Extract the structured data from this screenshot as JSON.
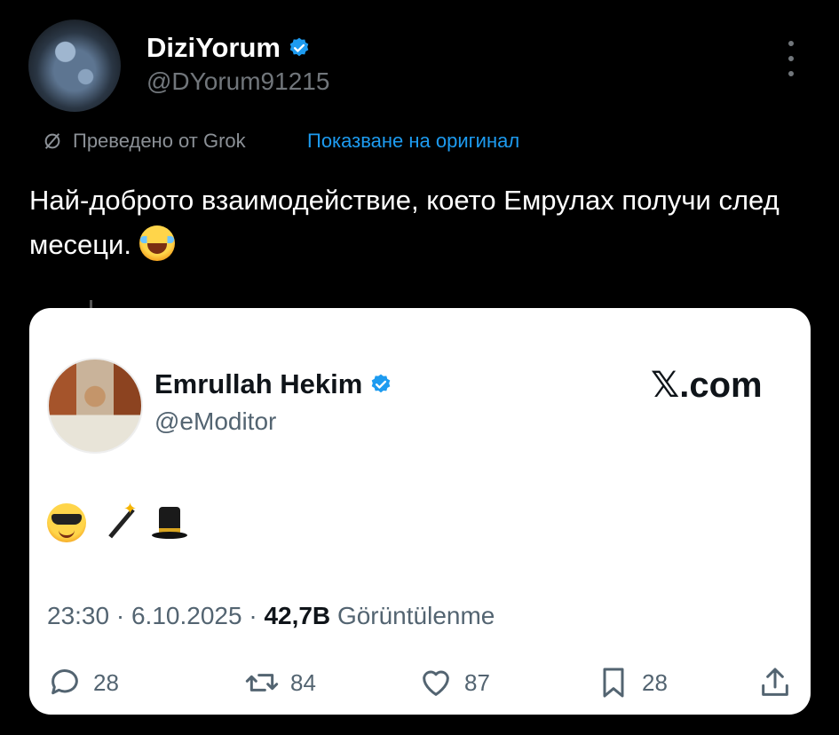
{
  "author": {
    "display_name": "DiziYorum",
    "handle": "@DYorum91215",
    "verified": true
  },
  "translation": {
    "label": "Преведено от Grok",
    "show_original": "Показване на оригинал"
  },
  "tweet": {
    "text": "Най-доброто взаимодействие, което Емрулах получи след месеци."
  },
  "embedded": {
    "display_name": "Emrullah Hekim",
    "handle": "@eModitor",
    "verified": true,
    "logo_text": "𝕏.com",
    "emojis": [
      "smiling-face-with-sunglasses",
      "magic-wand",
      "top-hat"
    ],
    "time": "23:30",
    "separator": "·",
    "date": "6.10.2025",
    "views_count": "42,7B",
    "views_label": "Görüntülenme",
    "actions": {
      "replies": "28",
      "reposts": "84",
      "likes": "87",
      "bookmarks": "28"
    }
  },
  "colors": {
    "background": "#000000",
    "accent": "#1d9bf0",
    "card": "#ffffff"
  }
}
